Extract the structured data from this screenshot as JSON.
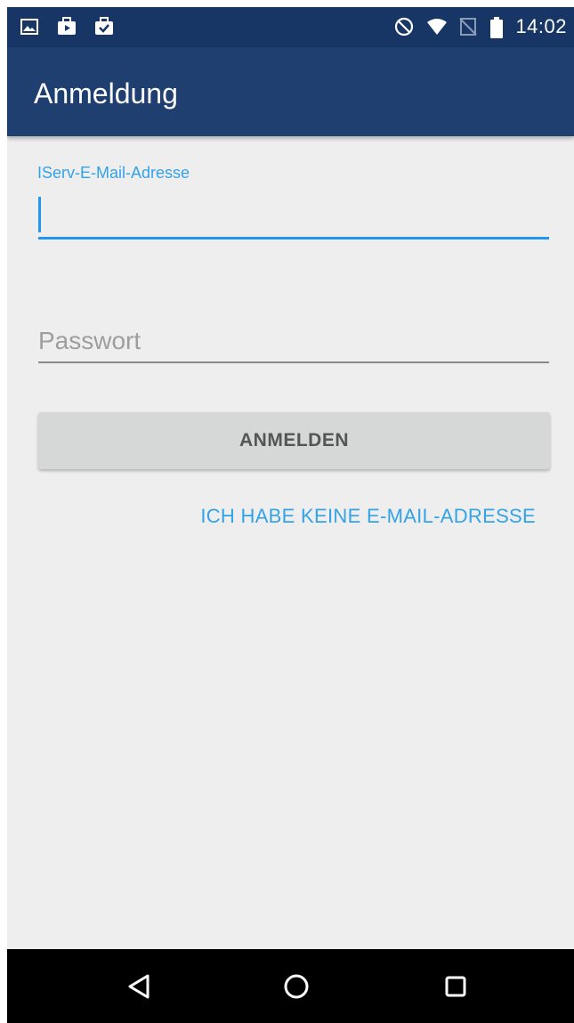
{
  "status_bar": {
    "time": "14:02",
    "left_icons": [
      "image-icon",
      "briefcase-play-icon",
      "briefcase-check-icon"
    ],
    "right_icons": [
      "do-not-disturb-icon",
      "wifi-icon",
      "no-sim-icon",
      "battery-icon"
    ]
  },
  "app_bar": {
    "title": "Anmeldung"
  },
  "form": {
    "email_label": "IServ-E-Mail-Adresse",
    "email_value": "",
    "password_placeholder": "Passwort",
    "password_value": "",
    "login_button_label": "ANMELDEN",
    "no_email_link": "ICH HABE KEINE E-MAIL-ADRESSE"
  },
  "nav_bar": {
    "icons": [
      "back-icon",
      "home-icon",
      "recents-icon"
    ]
  },
  "colors": {
    "status_bar": "#173666",
    "app_bar": "#1e3f6f",
    "accent": "#2196f3",
    "link": "#33a3e6",
    "background": "#eeeeee",
    "button": "#d6d7d7"
  }
}
